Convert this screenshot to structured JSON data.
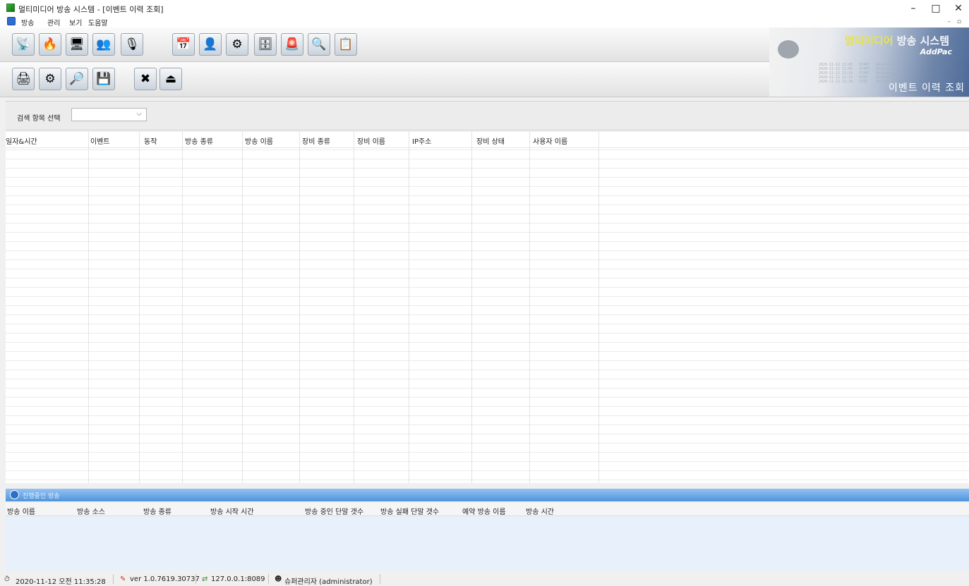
{
  "window": {
    "title": "멀티미디어 방송 시스템 - [이벤트 이력 조회]",
    "controls": {
      "minimize": "–",
      "restore": "□",
      "close": "✕"
    }
  },
  "menu": {
    "items": [
      "방송",
      "관리",
      "보기",
      "도움말"
    ],
    "mdi_controls": "– ▫"
  },
  "toolbar1": {
    "buttons": [
      {
        "name": "broadcast-icon",
        "glyph": "📡"
      },
      {
        "name": "emergency-broadcast-icon",
        "glyph": "🔥"
      },
      {
        "name": "device-control-icon",
        "glyph": "🖥"
      },
      {
        "name": "group-broadcast-icon",
        "glyph": "👥"
      },
      {
        "name": "voice-broadcast-icon",
        "glyph": "🎙"
      },
      {
        "name": "schedule-icon",
        "glyph": "📅"
      },
      {
        "name": "user-management-icon",
        "glyph": "👤"
      },
      {
        "name": "settings-icon",
        "glyph": "⚙"
      },
      {
        "name": "dns-server-icon",
        "glyph": "🗄"
      },
      {
        "name": "emergency-119-icon",
        "glyph": "🚨"
      },
      {
        "name": "search-icon",
        "glyph": "🔍"
      },
      {
        "name": "event-icon",
        "glyph": "📋"
      }
    ]
  },
  "toolbar2": {
    "buttons": [
      {
        "name": "print-icon",
        "glyph": "🖨"
      },
      {
        "name": "print-setup-icon",
        "glyph": "⚙"
      },
      {
        "name": "print-preview-icon",
        "glyph": "🔎"
      },
      {
        "name": "save-icon",
        "glyph": "💾"
      },
      {
        "name": "delete-icon",
        "glyph": "✖"
      },
      {
        "name": "exit-icon",
        "glyph": "⏏"
      }
    ]
  },
  "banner": {
    "title_highlight": "멀티미디어",
    "title_rest": " 방송 시스템",
    "brand": "AddPac",
    "page_name": "이벤트 이력 조회"
  },
  "search": {
    "label": "검색 항목 선택",
    "selected": ""
  },
  "event_table": {
    "columns": [
      "일자&시간",
      "이벤트",
      "동작",
      "방송 종류",
      "방송 이름",
      "장비 종류",
      "장비 이름",
      "IP주소",
      "장비 상태",
      "사용자 이름"
    ],
    "rows": []
  },
  "live_broadcast": {
    "title": "진행중인 방송",
    "columns": [
      "방송 이름",
      "방송 소스",
      "방송 종류",
      "방송 시작 시간",
      "방송 중인 단말 갯수",
      "방송 실패 단말 갯수",
      "예약 방송 이름",
      "방송 시간"
    ],
    "rows": []
  },
  "status": {
    "datetime": "2020-11-12 오전 11:35:28",
    "version": "ver 1.0.7619.30737",
    "server": "127.0.0.1:8089",
    "user": "슈퍼관리자 (administrator)"
  },
  "colors": {
    "live_header": "#5c9fe3",
    "banner_accent": "#4c6a98",
    "highlight": "#e8e34a"
  }
}
